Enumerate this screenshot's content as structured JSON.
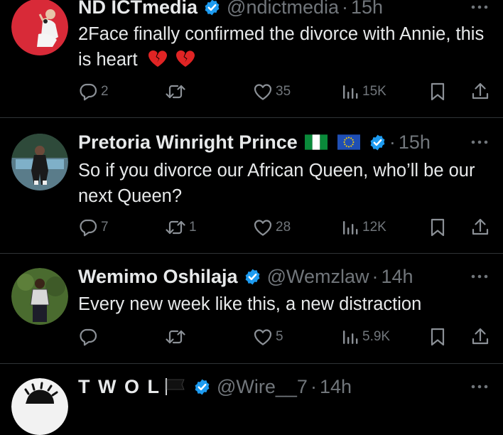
{
  "tweets": [
    {
      "name": "ND ICTmedia",
      "handle": "@ndictmedia",
      "time": "15h",
      "text": "2Face finally confirmed the divorce with Annie, this is heart",
      "text_emoji": "broken-heart-emoji x2",
      "replies": "2",
      "reposts": "",
      "likes": "35",
      "views": "15K"
    },
    {
      "name": "Pretoria Winright Prince",
      "flags": [
        "nigeria-flag",
        "eu-flag"
      ],
      "handle": "",
      "time": "15h",
      "text": "So if you divorce our African Queen, who’ll be our next Queen?",
      "replies": "7",
      "reposts": "1",
      "likes": "28",
      "views": "12K"
    },
    {
      "name": "Wemimo Oshilaja",
      "handle": "@Wemzlaw",
      "time": "14h",
      "text": "Every new week like this, a new distraction",
      "replies": "",
      "reposts": "",
      "likes": "5",
      "views": "5.9K"
    },
    {
      "name": "T W O L",
      "flags": [
        "black-flag"
      ],
      "handle": "@Wire__7",
      "time": "14h"
    }
  ],
  "separator": "·",
  "colors": {
    "background": "#000000",
    "text": "#e7e9ea",
    "muted": "#71767b",
    "verified": "#1d9bf0",
    "divider": "#2f3336"
  }
}
